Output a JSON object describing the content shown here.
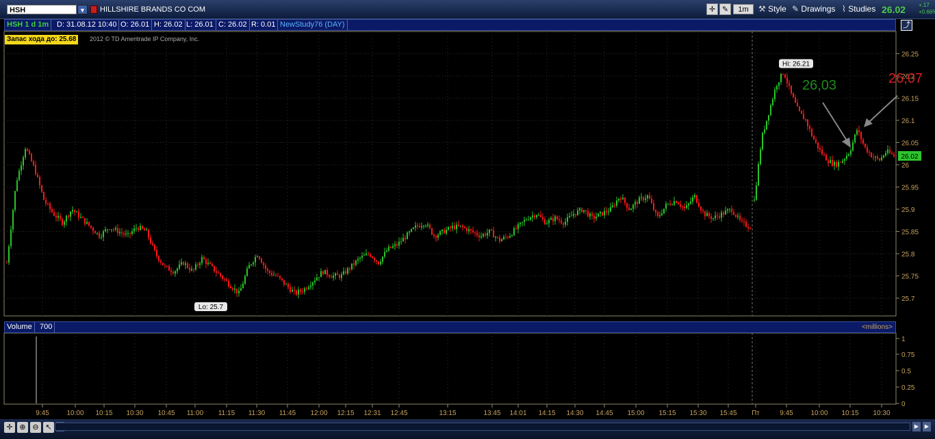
{
  "toolbar": {
    "symbol": "HSH",
    "company": "HILLSHIRE BRANDS CO COM",
    "aggregation": "1m",
    "style_label": "Style",
    "drawings_label": "Drawings",
    "studies_label": "Studies",
    "last_price": "26.02",
    "change_abs": "+.17",
    "change_pct": "+0.66%"
  },
  "info_bar": {
    "title": "HSH 1 d 1m",
    "date": "D: 31.08.12 10:40",
    "open": "O: 26.01",
    "high": "H: 26.02",
    "low": "L: 26.01",
    "close": "C: 26.02",
    "range": "R: 0.01",
    "study": "NewStudy76 (DAY)"
  },
  "zapas_label": "Запас хода до:",
  "zapas_value": "25.68",
  "copyright": "2012 © TD Ameritrade IP Company, Inc.",
  "volume_panel": {
    "label": "Volume",
    "value": "700",
    "units": "<millions>"
  },
  "colors": {
    "up": "#29c629",
    "down": "#ff1818",
    "grid": "#2f2f2f",
    "axis": "#8e8a6a",
    "ann_green": "#1e8c1e",
    "ann_red": "#d42020"
  },
  "chart_data": {
    "type": "candlestick",
    "ylim": [
      25.66,
      26.3
    ],
    "yticks": [
      "25.7",
      "25.75",
      "25.8",
      "25.85",
      "25.9",
      "25.95",
      "26",
      "26.05",
      "26.1",
      "26.15",
      "26.2",
      "26.25"
    ],
    "xticks": [
      "9:45",
      "10:00",
      "10:15",
      "10:30",
      "10:45",
      "11:00",
      "11:15",
      "11:30",
      "11:45",
      "12:00",
      "12:15",
      "12:31",
      "12:45",
      "13:15",
      "13:45",
      "14:01",
      "14:15",
      "14:30",
      "14:45",
      "15:00",
      "15:15",
      "15:30",
      "15:45",
      "Пт",
      "9:45",
      "10:00",
      "10:15",
      "10:30"
    ],
    "high_label": "Hi: 26.21",
    "low_label": "Lo: 25.7",
    "annotation_green": "26,03",
    "annotation_red": "26,07",
    "current_price": "26.02",
    "session_path": [
      25.78,
      25.96,
      26.04,
      25.99,
      25.92,
      25.89,
      25.87,
      25.9,
      25.88,
      25.86,
      25.84,
      25.86,
      25.85,
      25.84,
      25.86,
      25.85,
      25.8,
      25.77,
      25.76,
      25.78,
      25.76,
      25.79,
      25.77,
      25.75,
      25.73,
      25.71,
      25.77,
      25.8,
      25.76,
      25.75,
      25.73,
      25.71,
      25.72,
      25.74,
      25.76,
      25.75,
      25.75,
      25.77,
      25.79,
      25.8,
      25.78,
      25.81,
      25.82,
      25.84,
      25.86,
      25.87,
      25.84,
      25.85,
      25.86,
      25.86,
      25.85,
      25.84,
      25.85,
      25.83,
      25.84,
      25.86,
      25.88,
      25.89,
      25.87,
      25.88,
      25.87,
      25.89,
      25.9,
      25.88,
      25.89,
      25.9,
      25.93,
      25.9,
      25.92,
      25.93,
      25.88,
      25.91,
      25.92,
      25.9,
      25.93,
      25.89,
      25.88,
      25.89,
      25.9,
      25.87,
      25.86
    ],
    "day2_path": [
      25.92,
      26.06,
      26.12,
      26.18,
      26.21,
      26.16,
      26.12,
      26.1,
      26.06,
      26.03,
      26.01,
      26.0,
      26.01,
      26.03,
      26.08,
      26.04,
      26.02,
      26.01,
      26.03,
      26.02
    ],
    "volume_yticks": [
      "1",
      "0.75",
      "0.5",
      "0.25",
      "0"
    ]
  }
}
